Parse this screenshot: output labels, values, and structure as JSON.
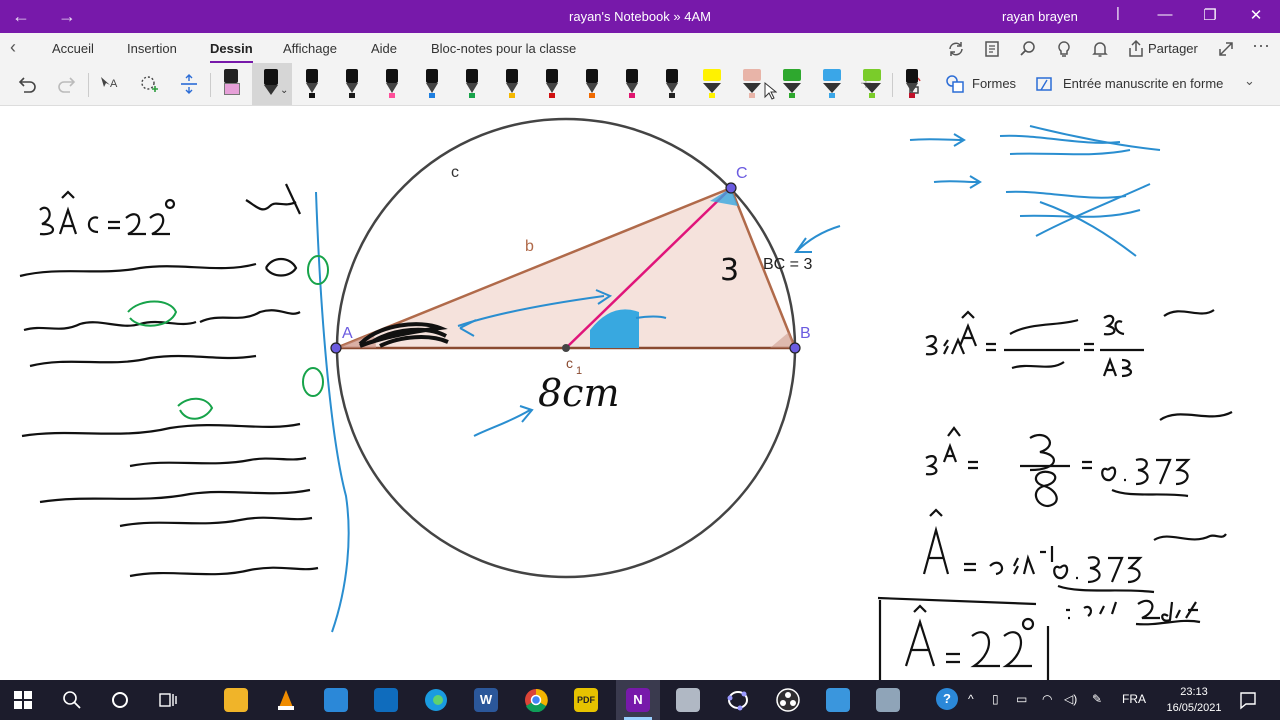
{
  "titlebar": {
    "back": "←",
    "forward": "→",
    "title": "rayan's Notebook » 4AM",
    "user": "rayan brayen",
    "minimize": "—",
    "restore": "❐",
    "close": "✕"
  },
  "tabs": [
    {
      "label": "Accueil"
    },
    {
      "label": "Insertion"
    },
    {
      "label": "Dessin"
    },
    {
      "label": "Affichage"
    },
    {
      "label": "Aide"
    },
    {
      "label": "Bloc-notes pour la classe"
    }
  ],
  "ribbon": {
    "share_label": "Partager",
    "shapes_label": "Formes",
    "ink_shape_label": "Entrée manuscrite en forme",
    "pen_colors": [
      "#111111",
      "#1a1a1a",
      "#ff4f9a",
      "#1e7fe0",
      "#17a34a",
      "#f5b800",
      "#d01010",
      "#f06a00",
      "#e0156f",
      "#222222",
      "#fff200",
      "#e8b4a8",
      "#2ea82e",
      "#3aa6e8",
      "#7acc2a",
      "#c0112a"
    ]
  },
  "figure": {
    "label_A": "A",
    "label_B": "B",
    "label_C": "C",
    "label_c": "c",
    "label_b": "b",
    "label_c1": "c",
    "label_c1_sub": "1",
    "bc_label": "BC = 3",
    "handwritten_3": "3",
    "handwritten_8cm": "8cm"
  },
  "taskbar": {
    "lang": "FRA",
    "time": "23:13",
    "date": "16/05/2021"
  }
}
